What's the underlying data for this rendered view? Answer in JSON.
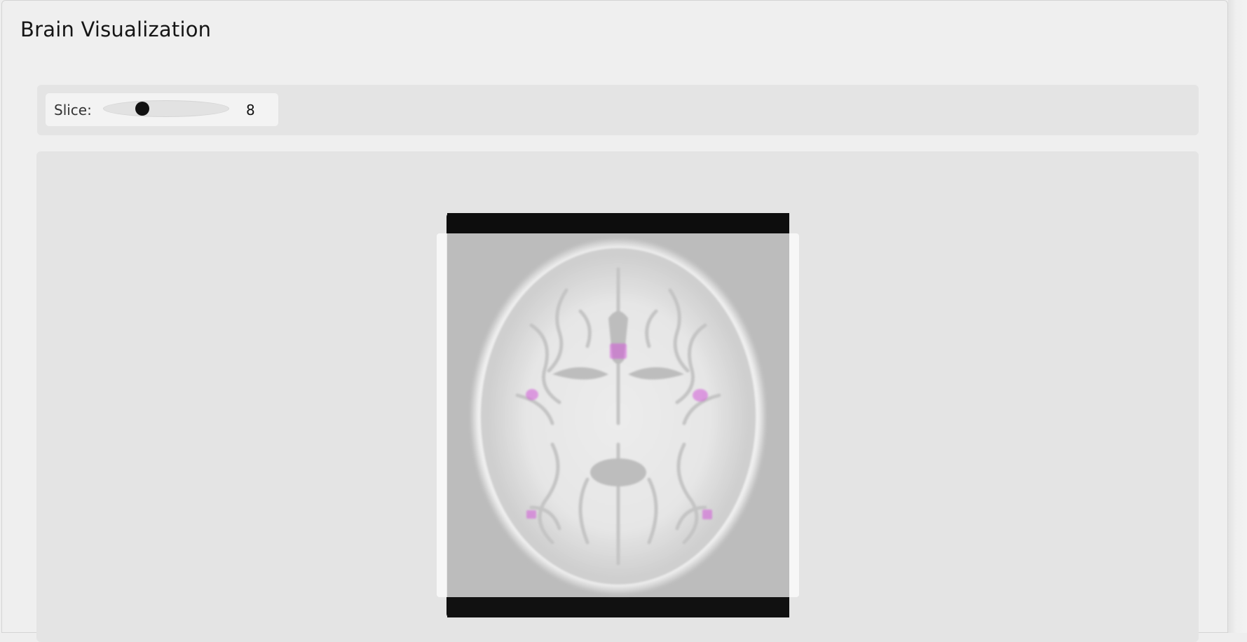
{
  "app": {
    "title": "Brain Visualization"
  },
  "controls": {
    "slice_label": "Slice:",
    "slice_value": "8",
    "slice_fraction": 0.28
  },
  "viewer": {
    "image_description_icon": "brain-axial-slice",
    "highlight_color": "#d25ad8",
    "background_color": "#bcbcbc"
  }
}
